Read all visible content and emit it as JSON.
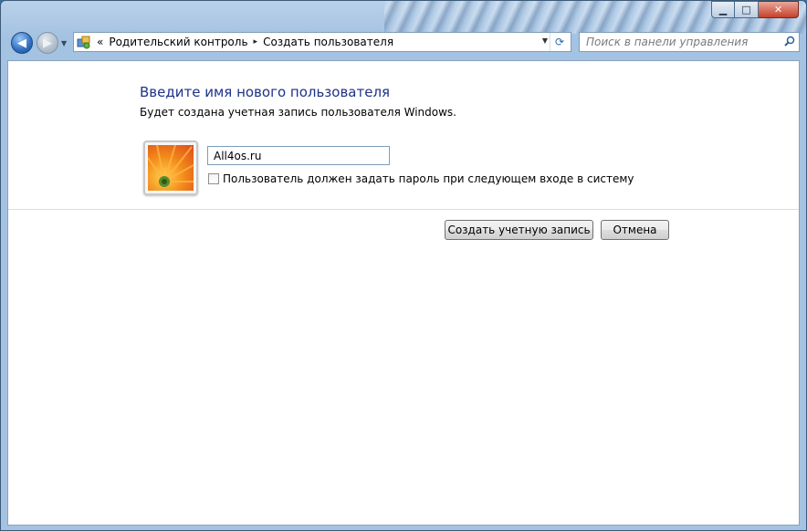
{
  "window": {
    "caption": {
      "minimize": "▁",
      "maximize": "□",
      "close": "✕"
    }
  },
  "address_bar": {
    "overflow": "«",
    "breadcrumbs": [
      "Родительский контроль",
      "Создать пользователя"
    ],
    "separator": "▸",
    "icon": "control-panel-icon"
  },
  "search": {
    "placeholder": "Поиск в панели управления",
    "icon": "search-icon"
  },
  "main": {
    "title": "Введите имя нового пользователя",
    "subtitle": "Будет создана учетная запись пользователя Windows.",
    "user_name_value": "All4os.ru",
    "checkbox_label": "Пользователь должен задать пароль при следующем входе в систему",
    "checkbox_checked": false,
    "avatar": "flower-avatar-icon"
  },
  "buttons": {
    "create": "Создать учетную запись",
    "cancel": "Отмена"
  },
  "colors": {
    "title": "#1e3287",
    "frame": "#a4c2e2",
    "close_button": "#c7402a"
  }
}
